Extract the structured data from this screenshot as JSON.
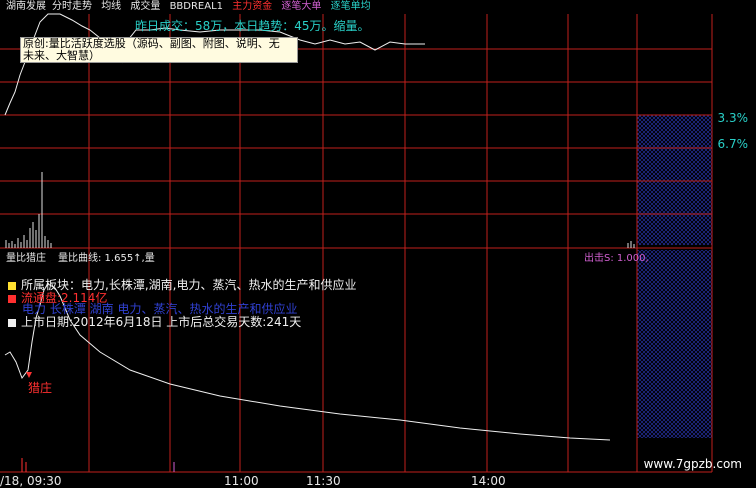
{
  "header": {
    "stock_name": "湖南发展",
    "tab_intraday": "分时走势",
    "tab_avg": "均线",
    "tab_volume": "成交量",
    "tab_indicator": "BBDREAL1",
    "tab_main_funds": "主力资金",
    "tab_big_orders": "逐笔大单",
    "tab_order_avg": "逐笔单均"
  },
  "volume_summary": "昨日成交：58万，本日趋势：45万。缩量。",
  "tooltip": {
    "line1": "原创:量比活跃度选股（源码、副图、附图、说明、无",
    "line2": "未来、大智慧）"
  },
  "right_scale": {
    "upper": "3.3%",
    "lower": "6.7%"
  },
  "sub_panel": {
    "title": "量比猎庄",
    "curve_label": "量比曲线: 1.655↑,量",
    "exit_label": "出击S: 1.000,",
    "marker_label": "猎庄"
  },
  "info": {
    "sector_label": "所属板块：",
    "sector_value": "电力,长株潭,湖南,电力、蒸汽、热水的生产和供应业",
    "float_cap": "流通盘:2.114亿",
    "overlap_text": "电力 长株潭 湖南 电力、蒸汽、热水的生产和供应业",
    "listing": "上市日期:2012年6月18日 上市后总交易天数:241天"
  },
  "time_axis": {
    "first": "/18, 09:30",
    "t1": "11:00",
    "t2": "11:30",
    "t3": "14:00"
  },
  "watermark": "www.7gpzb.com",
  "colors": {
    "grid": "#c0201c",
    "price_line": "#f0f0f0",
    "accent_cyan": "#29d0c8",
    "accent_red": "#ff3030",
    "accent_magenta": "#d060d0",
    "hatch": "#2a36b8"
  }
}
